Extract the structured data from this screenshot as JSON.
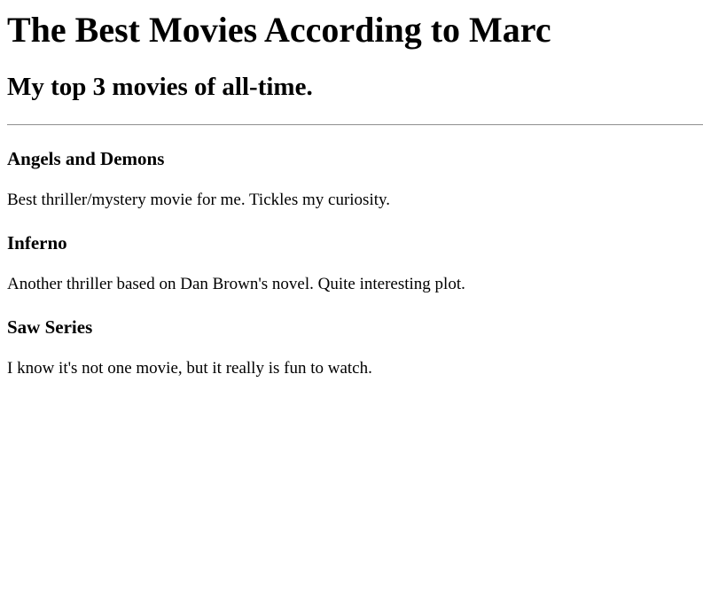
{
  "page": {
    "title": "The Best Movies According to Marc",
    "subtitle": "My top 3 movies of all-time."
  },
  "movies": [
    {
      "title": "Angels and Demons",
      "description": "Best thriller/mystery movie for me. Tickles my curiosity."
    },
    {
      "title": "Inferno",
      "description": "Another thriller based on Dan Brown's novel. Quite interesting plot."
    },
    {
      "title": "Saw Series",
      "description": "I know it's not one movie, but it really is fun to watch."
    }
  ]
}
